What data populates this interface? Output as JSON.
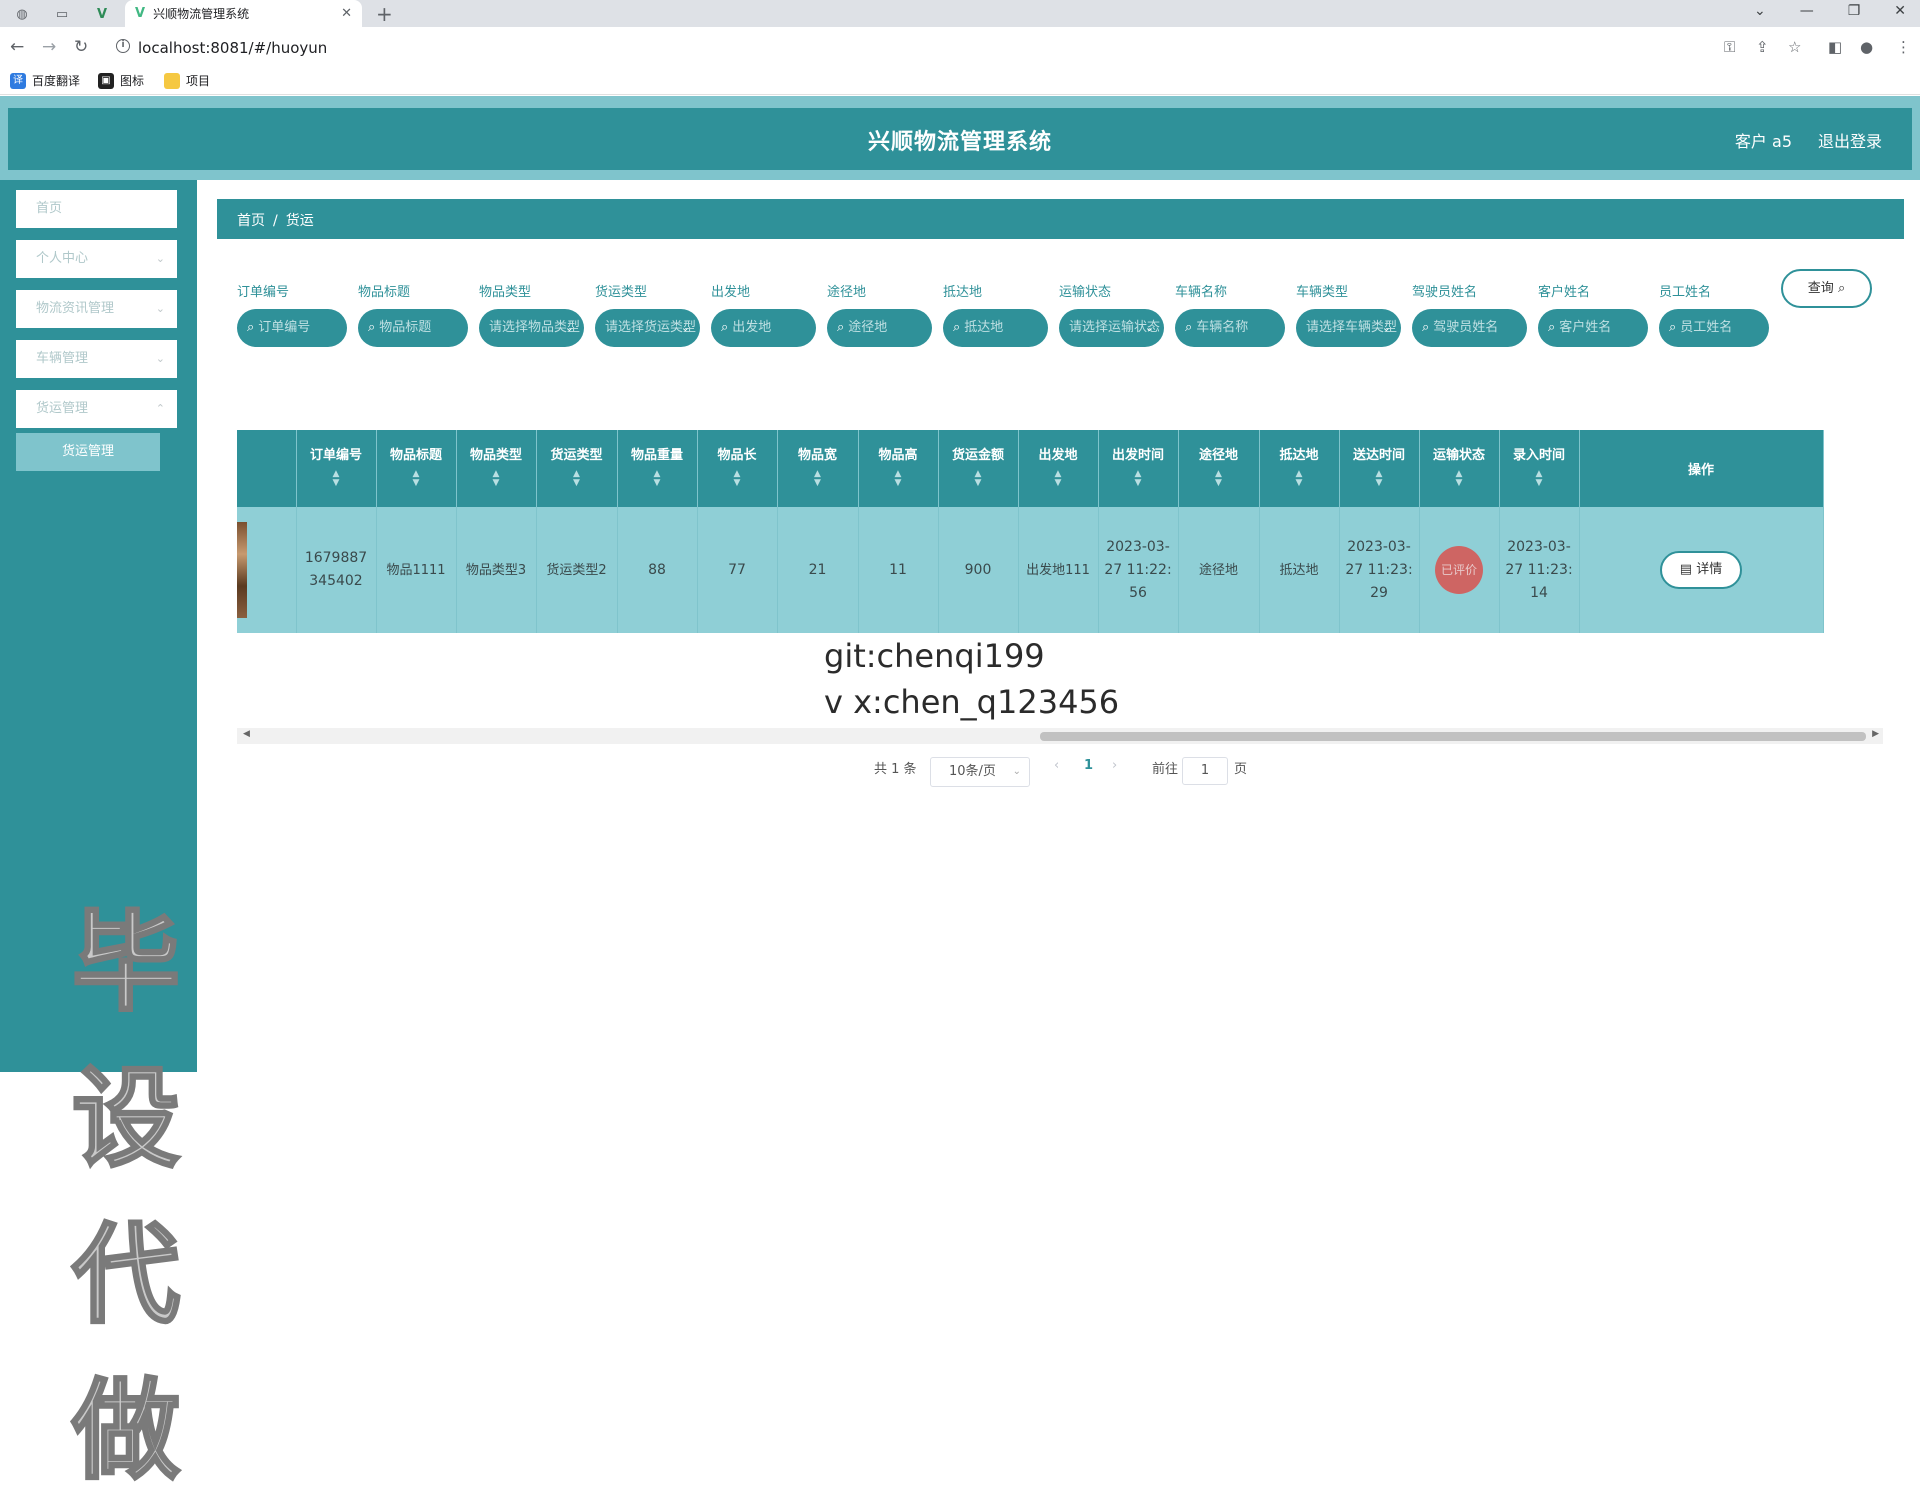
{
  "browser": {
    "tab_title": "兴顺物流管理系统",
    "url": "localhost:8081/#/huoyun",
    "bookmarks": [
      "百度翻译",
      "图标",
      "项目"
    ]
  },
  "header": {
    "title": "兴顺物流管理系统",
    "user": "客户 a5",
    "logout": "退出登录"
  },
  "sidebar": {
    "items": [
      {
        "label": "首页"
      },
      {
        "label": "个人中心"
      },
      {
        "label": "物流资讯管理"
      },
      {
        "label": "车辆管理"
      },
      {
        "label": "货运管理"
      }
    ],
    "sub_item": "货运管理"
  },
  "breadcrumb": {
    "home": "首页",
    "current": "货运"
  },
  "search": {
    "fields": [
      {
        "label": "订单编号",
        "placeholder": "订单编号"
      },
      {
        "label": "物品标题",
        "placeholder": "物品标题"
      },
      {
        "label": "物品类型",
        "placeholder": "请选择物品类型"
      },
      {
        "label": "货运类型",
        "placeholder": "请选择货运类型"
      },
      {
        "label": "出发地",
        "placeholder": "出发地"
      },
      {
        "label": "途径地",
        "placeholder": "途径地"
      },
      {
        "label": "抵达地",
        "placeholder": "抵达地"
      },
      {
        "label": "运输状态",
        "placeholder": "请选择运输状态"
      },
      {
        "label": "车辆名称",
        "placeholder": "车辆名称"
      },
      {
        "label": "车辆类型",
        "placeholder": "请选择车辆类型"
      },
      {
        "label": "驾驶员姓名",
        "placeholder": "驾驶员姓名"
      },
      {
        "label": "客户姓名",
        "placeholder": "客户姓名"
      },
      {
        "label": "员工姓名",
        "placeholder": "员工姓名"
      }
    ],
    "query_button": "查询"
  },
  "table": {
    "headers": [
      "订单编号",
      "物品标题",
      "物品类型",
      "货运类型",
      "物品重量",
      "物品长",
      "物品宽",
      "物品高",
      "货运金额",
      "出发地",
      "出发时间",
      "途径地",
      "抵达地",
      "送达时间",
      "运输状态",
      "录入时间",
      "操作"
    ],
    "row": {
      "order_no": "1679887345402",
      "title": "物品1111",
      "item_type": "物品类型3",
      "freight_type": "货运类型2",
      "weight": "88",
      "length": "77",
      "width": "21",
      "height": "11",
      "amount": "900",
      "origin": "出发地111",
      "depart_time": "2023-03-27 11:22:56",
      "via": "途径地",
      "destination": "抵达地",
      "arrive_time": "2023-03-27 11:23:29",
      "status": "已评价",
      "created": "2023-03-27 11:23:14",
      "action": "详情"
    }
  },
  "pagination": {
    "total": "共 1 条",
    "page_size": "10条/页",
    "current": "1",
    "goto_label": "前往",
    "goto_value": "1",
    "page_unit": "页"
  },
  "watermarks": {
    "line1": "git:chenqi199",
    "line2": "v x:chen_q123456",
    "big": "毕设代做"
  }
}
